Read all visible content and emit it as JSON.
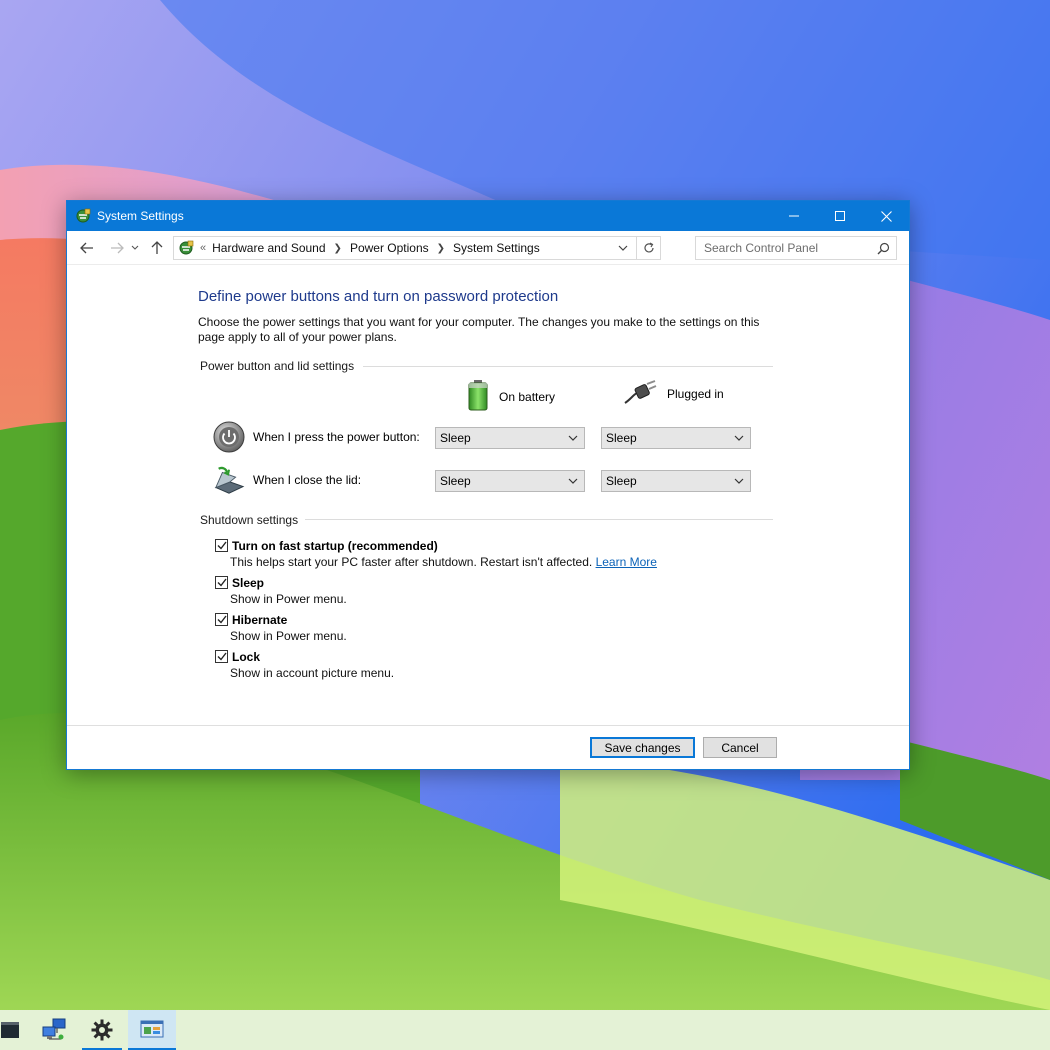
{
  "window": {
    "title": "System Settings",
    "controls": {
      "minimize": "minimize",
      "maximize": "maximize",
      "close": "close"
    }
  },
  "navigation": {
    "breadcrumb_prefix": "«",
    "breadcrumbs": [
      "Hardware and Sound",
      "Power Options",
      "System Settings"
    ],
    "search_placeholder": "Search Control Panel"
  },
  "page": {
    "title": "Define power buttons and turn on password protection",
    "description": "Choose the power settings that you want for your computer. The changes you make to the settings on this page apply to all of your power plans."
  },
  "power_settings": {
    "group_title": "Power button and lid settings",
    "columns": [
      {
        "label": "On battery",
        "icon": "battery-icon"
      },
      {
        "label": "Plugged in",
        "icon": "power-plug-icon"
      }
    ],
    "rows": [
      {
        "label": "When I press the power button:",
        "icon": "power-button-icon",
        "on_battery": "Sleep",
        "plugged_in": "Sleep"
      },
      {
        "label": "When I close the lid:",
        "icon": "laptop-lid-icon",
        "on_battery": "Sleep",
        "plugged_in": "Sleep"
      }
    ]
  },
  "shutdown_settings": {
    "group_title": "Shutdown settings",
    "items": [
      {
        "label": "Turn on fast startup (recommended)",
        "checked": true,
        "description": "This helps start your PC faster after shutdown. Restart isn't affected.",
        "link": "Learn More"
      },
      {
        "label": "Sleep",
        "checked": true,
        "description": "Show in Power menu."
      },
      {
        "label": "Hibernate",
        "checked": true,
        "description": "Show in Power menu."
      },
      {
        "label": "Lock",
        "checked": true,
        "description": "Show in account picture menu."
      }
    ]
  },
  "footer": {
    "save_label": "Save changes",
    "cancel_label": "Cancel"
  },
  "taskbar": {
    "items": [
      "terminal-icon",
      "network-computers-icon",
      "settings-gear-icon",
      "control-panel-icon"
    ],
    "active_index": 3
  },
  "colors": {
    "titlebar": "#0a78d7",
    "heading": "#1e3a8c",
    "link": "#0c63b8"
  }
}
